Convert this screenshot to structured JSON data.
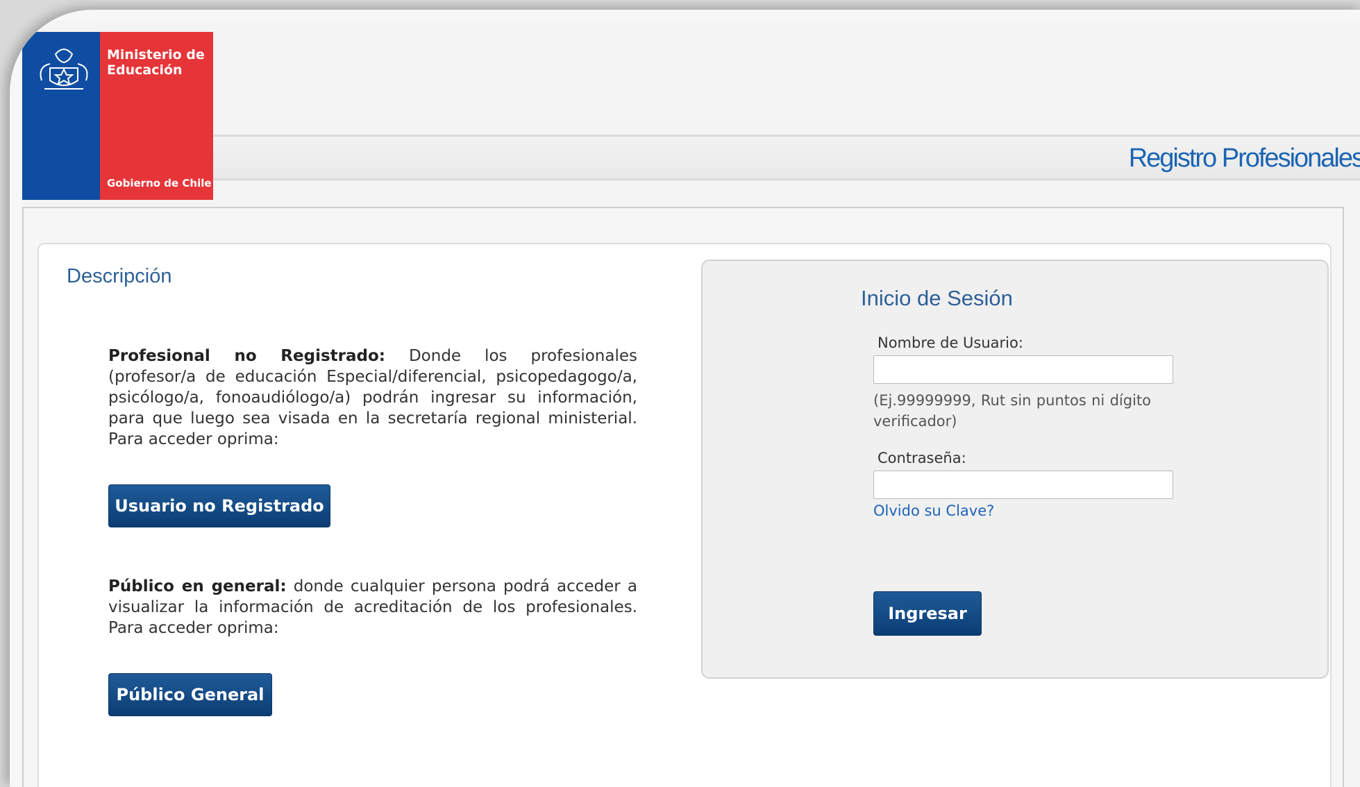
{
  "header": {
    "logo": {
      "line1": "Ministerio de",
      "line2": "Educación",
      "government": "Gobierno de Chile",
      "colors": {
        "blue": "#0e4da1",
        "red": "#e63539"
      },
      "emblem_icon": "coat-of-arms-icon"
    },
    "site_title": "Registro Profesionales"
  },
  "description": {
    "title": "Descripción",
    "unregistered": {
      "bold": "Profesional no Registrado:",
      "text": " Donde los profesionales (profesor/a de educación Especial/diferencial, psicopedagogo/a, psicólogo/a, fonoaudiólogo/a) podrán ingresar su información, para que luego sea visada en la secretaría regional ministerial. Para acceder oprima:",
      "button": "Usuario no Registrado"
    },
    "public": {
      "bold": "Público en general:",
      "text": " donde cualquier persona podrá acceder a visualizar la información de acreditación de los profesionales. Para acceder oprima:",
      "button": "Público General"
    }
  },
  "login": {
    "title": "Inicio de Sesión",
    "username_label": "Nombre de Usuario:",
    "username_value": "",
    "username_hint": "(Ej.99999999, Rut sin puntos ni dígito verificador)",
    "password_label": "Contraseña:",
    "password_value": "",
    "forgot_link": "Olvido su Clave?",
    "submit_button": "Ingresar"
  },
  "colors": {
    "accent_blue": "#2c5f98",
    "button_blue": "#0b3d74",
    "link_blue": "#1d63b8"
  }
}
